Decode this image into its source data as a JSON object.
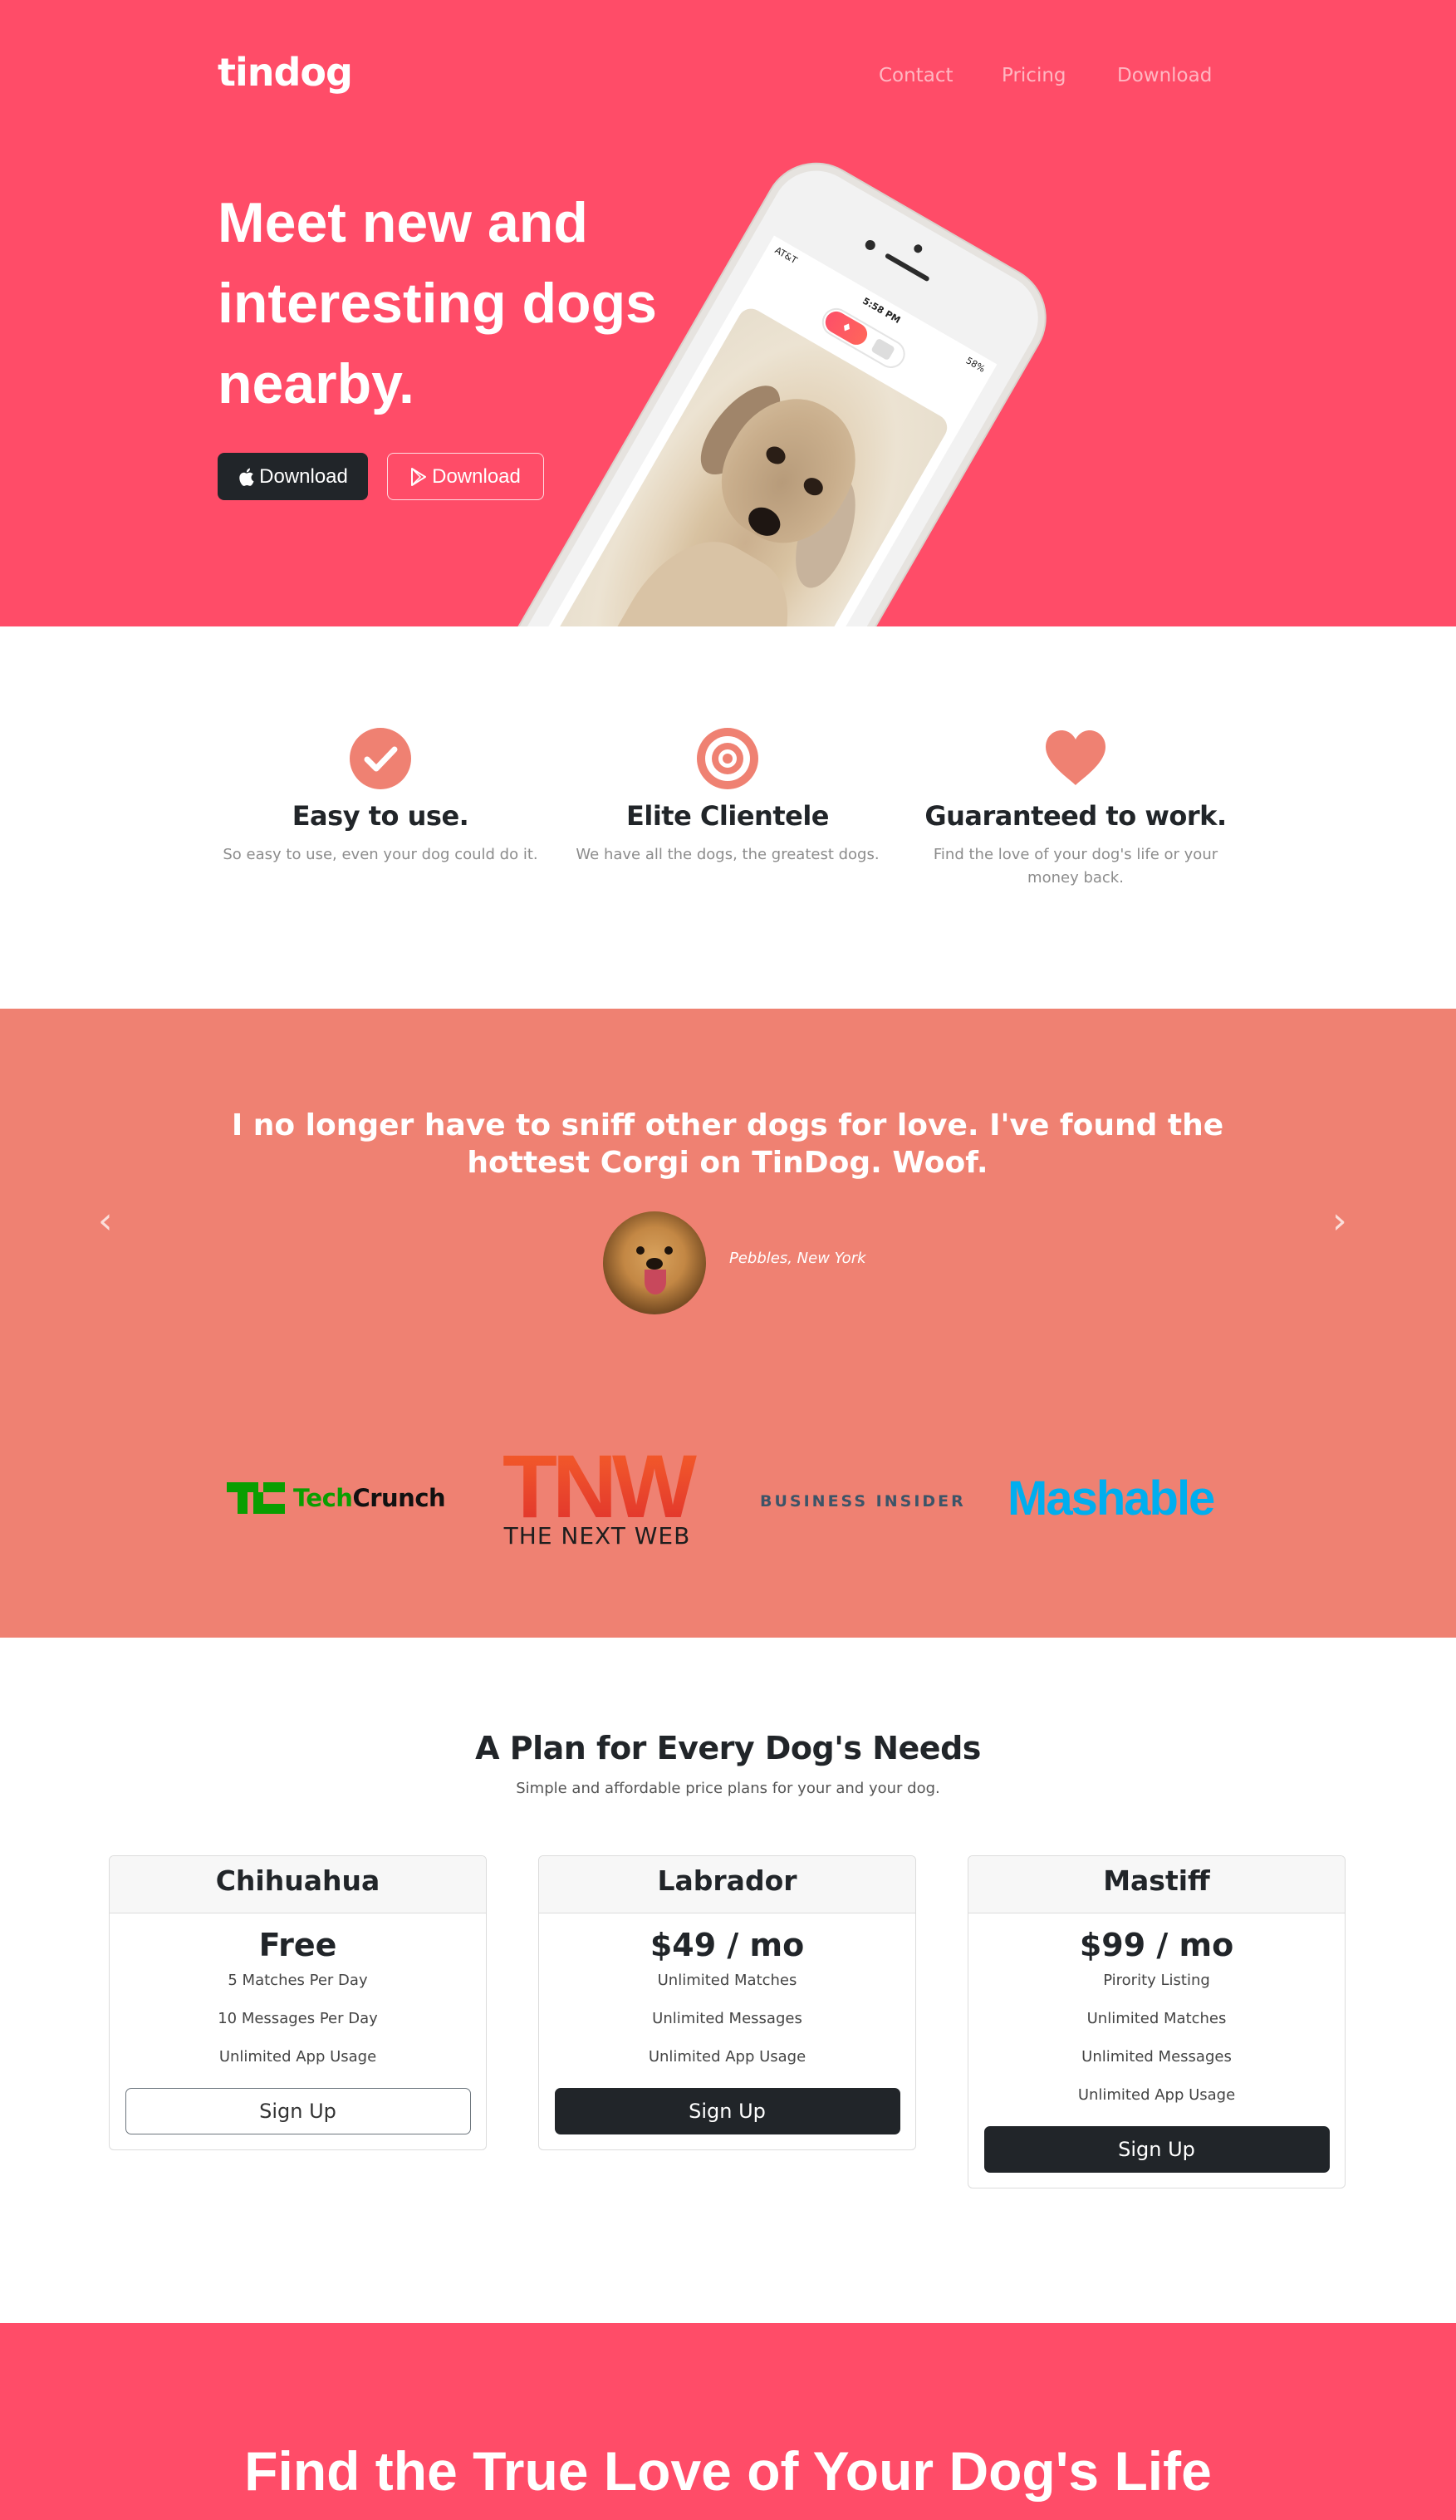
{
  "nav": {
    "brand": "tindog",
    "links": [
      "Contact",
      "Pricing",
      "Download"
    ]
  },
  "hero": {
    "title": "Meet new and interesting dogs nearby.",
    "buttons": [
      {
        "label": "Download",
        "icon": "apple-icon"
      },
      {
        "label": "Download",
        "icon": "google-play-icon"
      }
    ],
    "phone": {
      "carrier": "AT&T",
      "time": "5:58 PM",
      "battery": "58%"
    }
  },
  "features": [
    {
      "icon": "check-circle-icon",
      "title": "Easy to use.",
      "text": "So easy to use, even your dog could do it."
    },
    {
      "icon": "bullseye-icon",
      "title": "Elite Clientele",
      "text": "We have all the dogs, the greatest dogs."
    },
    {
      "icon": "heart-icon",
      "title": "Guaranteed to work.",
      "text": "Find the love of your dog's life or your money back."
    }
  ],
  "testimonial": {
    "quote": "I no longer have to sniff other dogs for love. I've found the hottest Corgi on TinDog. Woof.",
    "author": "Pebbles, New York",
    "prev_arrow": "‹",
    "next_arrow": "›"
  },
  "press": {
    "techcrunch_tech": "Tech",
    "techcrunch_crunch": "Crunch",
    "tnw_big": "TNW",
    "tnw_sub": "THE NEXT WEB",
    "business_insider": "BUSINESS INSIDER",
    "mashable": "Mashable"
  },
  "pricing": {
    "title": "A Plan for Every Dog's Needs",
    "subtitle": "Simple and affordable price plans for your and your dog.",
    "plans": [
      {
        "name": "Chihuahua",
        "price": "Free",
        "features": [
          "5 Matches Per Day",
          "10 Messages Per Day",
          "Unlimited App Usage"
        ],
        "button": "Sign Up"
      },
      {
        "name": "Labrador",
        "price": "$49 / mo",
        "features": [
          "Unlimited Matches",
          "Unlimited Messages",
          "Unlimited App Usage"
        ],
        "button": "Sign Up"
      },
      {
        "name": "Mastiff",
        "price": "$99 / mo",
        "features": [
          "Pirority Listing",
          "Unlimited Matches",
          "Unlimited Messages",
          "Unlimited App Usage"
        ],
        "button": "Sign Up"
      }
    ]
  },
  "cta": {
    "title": "Find the True Love of Your Dog's Life"
  },
  "colors": {
    "hero_bg": "#ff4c68",
    "testimonial_bg": "#ef8172",
    "accent": "#ef8172",
    "dark": "#212529"
  }
}
